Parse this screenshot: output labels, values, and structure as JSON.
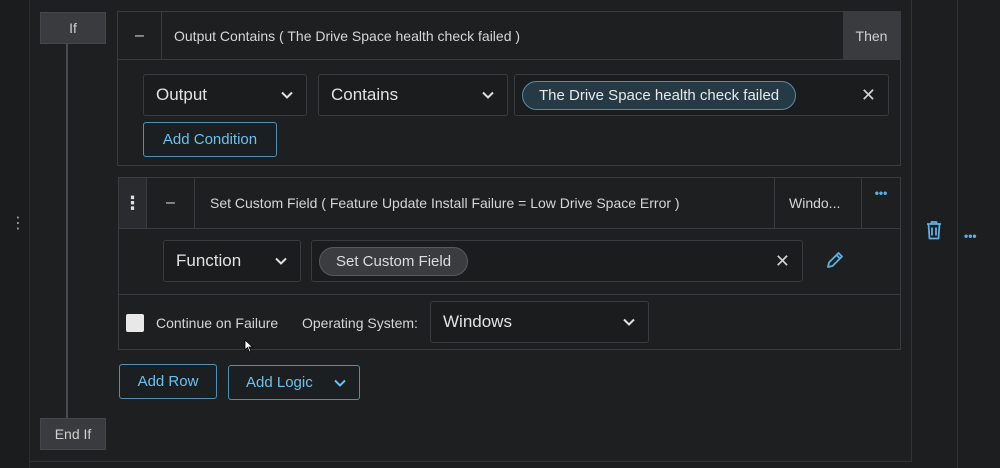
{
  "if_block": {
    "if_label": "If",
    "end_if_label": "End If",
    "then_label": "Then",
    "collapse_glyph": "–",
    "condition_title": "Output Contains ( The Drive Space health check failed )",
    "field_select": "Output",
    "operator_select": "Contains",
    "value_chip": "The Drive Space health check failed",
    "add_condition_label": "Add Condition"
  },
  "step": {
    "handle_glyph": "⋮",
    "collapse_glyph": "–",
    "title": "Set Custom Field ( Feature Update Install Failure = Low Drive Space Error )",
    "os_short": "Windo...",
    "more_glyph": "•••",
    "function_select": "Function",
    "function_chip": "Set Custom Field",
    "continue_on_failure_label": "Continue on Failure",
    "continue_on_failure_checked": false,
    "os_label": "Operating System:",
    "os_select": "Windows"
  },
  "footer": {
    "add_row_label": "Add Row",
    "add_logic_label": "Add Logic"
  },
  "side": {
    "left_handle_glyph": "⋮",
    "more_glyph": "•••"
  },
  "icons": [
    "vertical-dots-icon",
    "minus-icon",
    "chevron-down-icon",
    "close-icon",
    "pencil-icon",
    "trash-icon",
    "horizontal-dots-icon"
  ],
  "colors": {
    "accent": "#5fb0e2",
    "chip_border": "#5b8aa3",
    "background": "#1e1f21"
  }
}
